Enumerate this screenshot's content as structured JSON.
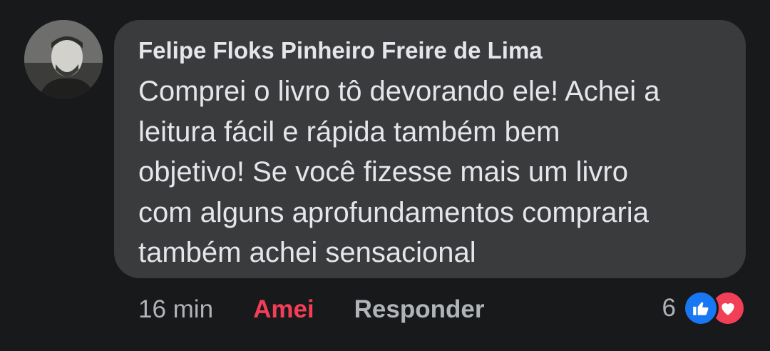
{
  "comment": {
    "author": "Felipe Floks Pinheiro Freire de Lima",
    "lines": [
      "Comprei o livro tô devorando ele! Achei a",
      "leitura fácil e rápida também bem",
      "objetivo! Se você fizesse mais um livro",
      "com alguns aprofundamentos compraria",
      "também achei sensacional"
    ],
    "avatar_icon": "profile-photo"
  },
  "actions": {
    "time": "16 min",
    "reaction_label": "Amei",
    "reply_label": "Responder"
  },
  "reactions": {
    "count": "6",
    "icons": [
      "like-icon",
      "love-icon"
    ]
  },
  "colors": {
    "background": "#18191a",
    "bubble": "#3a3b3c",
    "text": "#e4e6eb",
    "muted": "#b0b3b8",
    "love": "#f33e58",
    "like": "#1877f2"
  }
}
